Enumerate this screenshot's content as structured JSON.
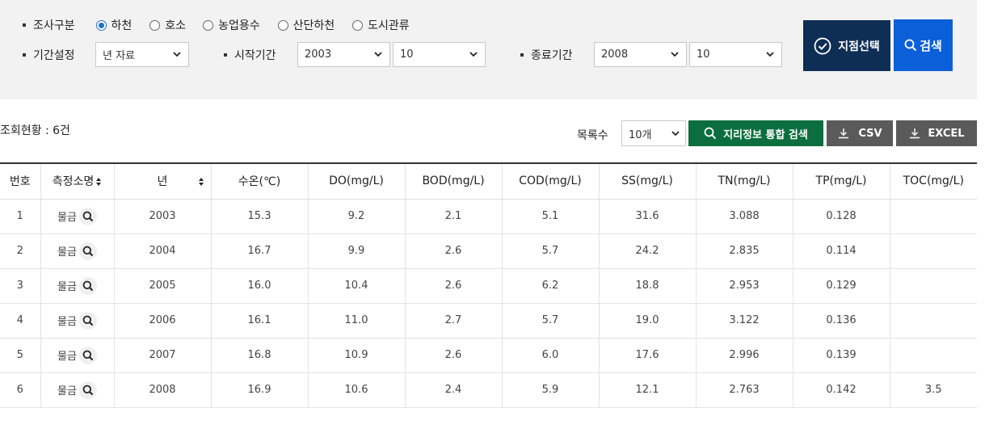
{
  "filters": {
    "survey_label": "조사구분",
    "survey_options": [
      {
        "label": "하천",
        "checked": true
      },
      {
        "label": "호소",
        "checked": false
      },
      {
        "label": "농업용수",
        "checked": false
      },
      {
        "label": "산단하천",
        "checked": false
      },
      {
        "label": "도시관류",
        "checked": false
      }
    ],
    "period_label": "기간설정",
    "period_value": "년 자료",
    "start_label": "시작기간",
    "start_year": "2003",
    "start_month": "10",
    "end_label": "종료기간",
    "end_year": "2008",
    "end_month": "10"
  },
  "actions": {
    "site_select_label": "지점선택",
    "search_label": "검색"
  },
  "toolbar": {
    "count_text": "조회현황 : 6건",
    "list_count_label": "목록수",
    "list_count_value": "10개",
    "geo_search_label": "지리정보 통합 검색",
    "csv_label": "CSV",
    "excel_label": "EXCEL"
  },
  "table": {
    "headers": [
      "번호",
      "측정소명",
      "년",
      "수온(℃)",
      "DO(mg/L)",
      "BOD(mg/L)",
      "COD(mg/L)",
      "SS(mg/L)",
      "TN(mg/L)",
      "TP(mg/L)",
      "TOC(mg/L)"
    ],
    "rows": [
      [
        "1",
        "물금",
        "2003",
        "15.3",
        "9.2",
        "2.1",
        "5.1",
        "31.6",
        "3.088",
        "0.128",
        ""
      ],
      [
        "2",
        "물금",
        "2004",
        "16.7",
        "9.9",
        "2.6",
        "5.7",
        "24.2",
        "2.835",
        "0.114",
        ""
      ],
      [
        "3",
        "물금",
        "2005",
        "16.0",
        "10.4",
        "2.6",
        "6.2",
        "18.8",
        "2.953",
        "0.129",
        ""
      ],
      [
        "4",
        "물금",
        "2006",
        "16.1",
        "11.0",
        "2.7",
        "5.7",
        "19.0",
        "3.122",
        "0.136",
        ""
      ],
      [
        "5",
        "물금",
        "2007",
        "16.8",
        "10.9",
        "2.6",
        "6.0",
        "17.6",
        "2.996",
        "0.139",
        ""
      ],
      [
        "6",
        "물금",
        "2008",
        "16.9",
        "10.6",
        "2.4",
        "5.9",
        "12.1",
        "2.763",
        "0.142",
        "3.5"
      ]
    ]
  },
  "colors": {
    "panel_bg": "#f2f2f2",
    "site_button": "#0f2e56",
    "search_button": "#0b5fd8",
    "geo_button": "#0c6e3e",
    "download_button": "#5a5a5a",
    "radio_accent": "#1f6fd1"
  },
  "icons": {
    "site_select": "check-circle-icon",
    "search": "search-icon",
    "download": "download-icon",
    "sort": "sort-icon",
    "chevron": "chevron-down-icon"
  }
}
